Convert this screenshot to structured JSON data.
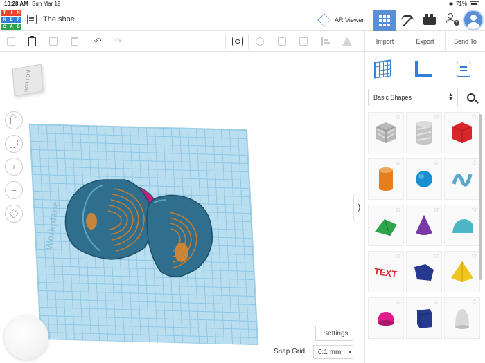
{
  "status_bar": {
    "time": "10:28 AM",
    "date": "Sun Mar 19",
    "battery": "71%"
  },
  "app": {
    "logo_letters": [
      "T",
      "I",
      "N",
      "K",
      "E",
      "R",
      "C",
      "A",
      "D"
    ],
    "logo_colors": [
      "#e8462f",
      "#e8462f",
      "#e8462f",
      "#2f7fd6",
      "#2f7fd6",
      "#2f7fd6",
      "#31a24c",
      "#31a24c",
      "#31a24c"
    ],
    "document_title": "The shoe",
    "ar_viewer_label": "AR Viewer",
    "accent": "#5a8fd6"
  },
  "actions": {
    "import": "Import",
    "export": "Export",
    "send_to": "Send To"
  },
  "workplane": {
    "viewcube_face": "BOTTOM",
    "plane_label": "Workplane",
    "settings_label": "Settings",
    "snap_grid_label": "Snap Grid",
    "snap_grid_value": "0.1 mm",
    "plane_color": "#b9def0"
  },
  "panel": {
    "category": "Basic Shapes",
    "shapes": [
      {
        "name": "box-striped",
        "color": "#b9b9b9"
      },
      {
        "name": "cylinder-striped",
        "color": "#c4c4c4"
      },
      {
        "name": "box",
        "color": "#d8262c"
      },
      {
        "name": "cylinder",
        "color": "#e67e1e"
      },
      {
        "name": "sphere",
        "color": "#1a8fd0"
      },
      {
        "name": "scribble",
        "color": "#5aa7cc"
      },
      {
        "name": "roof",
        "color": "#2fa44a"
      },
      {
        "name": "cone",
        "color": "#7a3aa6"
      },
      {
        "name": "round-roof",
        "color": "#4fb6c8"
      },
      {
        "name": "text",
        "color": "#d8262c"
      },
      {
        "name": "polygon",
        "color": "#25398f"
      },
      {
        "name": "pyramid",
        "color": "#f0c51e"
      },
      {
        "name": "half-sphere",
        "color": "#e01b8a"
      },
      {
        "name": "hexagonal-prism",
        "color": "#25398f"
      },
      {
        "name": "paraboloid",
        "color": "#d9d9d9"
      }
    ]
  }
}
